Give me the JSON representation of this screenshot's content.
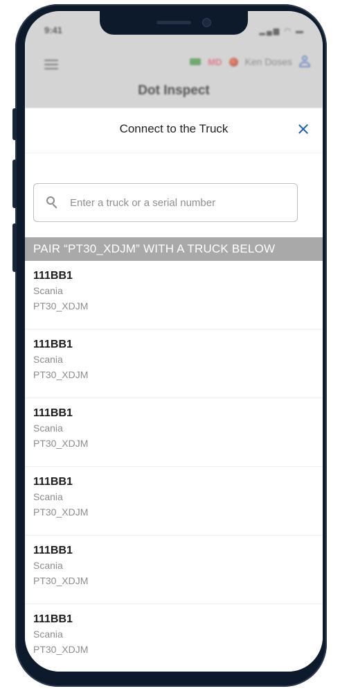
{
  "status_bar": {
    "time": "9:41"
  },
  "background_app": {
    "title": "Dot Inspect",
    "md_badge": "MD",
    "user_name": "Ken Doses"
  },
  "sheet": {
    "title": "Connect to the Truck",
    "search": {
      "placeholder": "Enter a truck or a serial number",
      "value": ""
    },
    "section_label": "PAIR “PT30_XDJM” WITH A TRUCK BELOW",
    "trucks": [
      {
        "id": "111BB1",
        "make": "Scania",
        "serial": "PT30_XDJM"
      },
      {
        "id": "111BB1",
        "make": "Scania",
        "serial": "PT30_XDJM"
      },
      {
        "id": "111BB1",
        "make": "Scania",
        "serial": "PT30_XDJM"
      },
      {
        "id": "111BB1",
        "make": "Scania",
        "serial": "PT30_XDJM"
      },
      {
        "id": "111BB1",
        "make": "Scania",
        "serial": "PT30_XDJM"
      },
      {
        "id": "111BB1",
        "make": "Scania",
        "serial": "PT30_XDJM"
      }
    ]
  },
  "colors": {
    "accent": "#1e5fb5",
    "section_bar": "#a9a9a9",
    "phone_frame": "#0d1a2b"
  }
}
